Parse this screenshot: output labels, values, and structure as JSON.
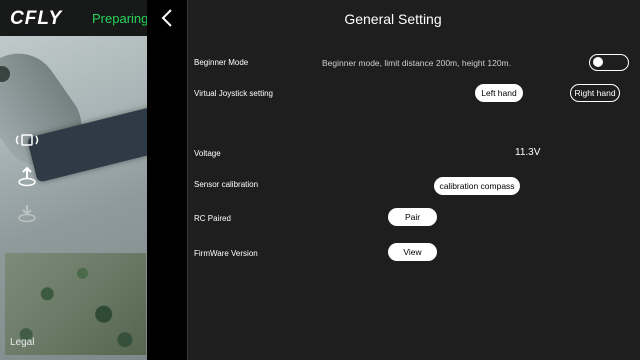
{
  "topbar": {
    "logo": "CFLY",
    "status": "Preparing",
    "status_color": "#24d35a"
  },
  "left": {
    "icons": [
      "phone-rotate-icon",
      "takeoff-icon",
      "landing-icon"
    ],
    "map_label": "Legal"
  },
  "panel": {
    "title": "General Setting",
    "rows": {
      "beginner": {
        "label": "Beginner Mode",
        "description": "Beginner mode, limit distance 200m, height 120m.",
        "toggle": "off"
      },
      "joystick": {
        "label": "Virtual Joystick setting",
        "left_hand": "Left hand",
        "right_hand": "Right hand"
      },
      "voltage": {
        "label": "Voltage",
        "value": "11.3V"
      },
      "sensor": {
        "label": "Sensor calibration",
        "button": "calibration compass"
      },
      "rc": {
        "label": "RC Paired",
        "button": "Pair"
      },
      "firmware": {
        "label": "FirmWare Version",
        "button": "View"
      }
    }
  }
}
